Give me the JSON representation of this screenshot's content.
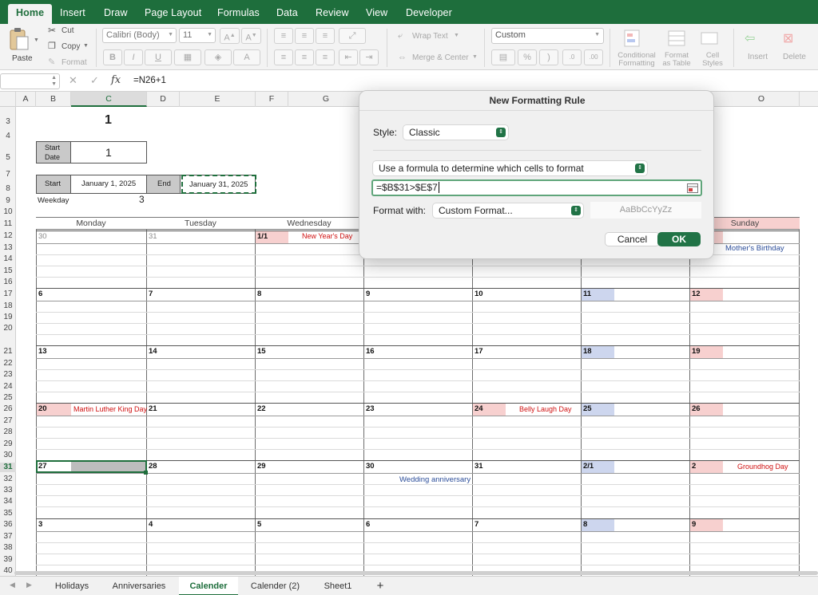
{
  "ribbon_tabs": [
    "Home",
    "Insert",
    "Draw",
    "Page Layout",
    "Formulas",
    "Data",
    "Review",
    "View",
    "Developer"
  ],
  "clipboard": {
    "paste": "Paste",
    "cut": "Cut",
    "copy": "Copy",
    "format": "Format"
  },
  "font": {
    "name": "Calibri (Body)",
    "size": "11",
    "bold": "B",
    "italic": "I",
    "underline": "U"
  },
  "alignment": {
    "wrap": "Wrap Text",
    "merge": "Merge & Center"
  },
  "number": {
    "format": "Custom",
    "percent": "%"
  },
  "styles": {
    "conditional": "Conditional\nFormatting",
    "format_table": "Format\nas Table",
    "cell_styles": "Cell\nStyles"
  },
  "cells": {
    "insert": "Insert",
    "delete": "Delete"
  },
  "formula_bar": {
    "fx": "fx",
    "formula": "=N26+1"
  },
  "columns": [
    "A",
    "B",
    "C",
    "D",
    "E",
    "F",
    "G",
    "O"
  ],
  "rows": [
    "3",
    "4",
    "5",
    "6",
    "7",
    "8",
    "9",
    "10",
    "11",
    "12",
    "13",
    "14",
    "15",
    "16",
    "17",
    "18",
    "19",
    "20",
    "21",
    "22",
    "23",
    "24",
    "25",
    "26",
    "27",
    "28",
    "29",
    "30",
    "31",
    "32",
    "33",
    "34",
    "35",
    "36",
    "37",
    "38",
    "39",
    "40"
  ],
  "sheet": {
    "year_value": "1",
    "start_date_label": "Start Date",
    "start_date_value": "1",
    "start_label": "Start",
    "start_value": "January 1, 2025",
    "end_label": "End",
    "end_value": "January 31, 2025",
    "weekday_label": "Weekday",
    "weekday_value": "3"
  },
  "weekdays": [
    "Monday",
    "Tuesday",
    "Wednesday",
    "Sunday"
  ],
  "calendar": {
    "w1": [
      "30",
      "31",
      "1/1"
    ],
    "w2": [
      "6",
      "7",
      "8",
      "9",
      "10",
      "11",
      "12"
    ],
    "w3": [
      "13",
      "14",
      "15",
      "16",
      "17",
      "18",
      "19"
    ],
    "w4": [
      "20",
      "21",
      "22",
      "23",
      "24",
      "25",
      "26"
    ],
    "w5": [
      "27",
      "28",
      "29",
      "30",
      "31",
      "2/1",
      "2"
    ],
    "w6": [
      "3",
      "4",
      "5",
      "6",
      "7",
      "8",
      "9"
    ],
    "events": {
      "new_year": "New Year's Day",
      "mother": "Mother's Birthday",
      "mlk": "Martin Luther King Day",
      "belly": "Belly Laugh Day",
      "wedding": "Wedding anniversary",
      "groundhog": "Groundhog Day"
    }
  },
  "sheet_tabs": [
    "Holidays",
    "Anniversaries",
    "Calender",
    "Calender (2)",
    "Sheet1",
    "+"
  ],
  "dialog": {
    "title": "New Formatting Rule",
    "style_label": "Style:",
    "style_value": "Classic",
    "rule_type": "Use a formula to determine which cells to format",
    "formula": "=$B$31>$E$7",
    "format_with_label": "Format with:",
    "format_with_value": "Custom Format...",
    "preview": "AaBbCcYyZz",
    "cancel": "Cancel",
    "ok": "OK"
  },
  "colors": {
    "accent": "#1e6e3c",
    "holiday": "#f7d0cf",
    "weekend": "#cdd6ee",
    "event_red": "#d01010",
    "event_blue": "#2c4e9a"
  }
}
